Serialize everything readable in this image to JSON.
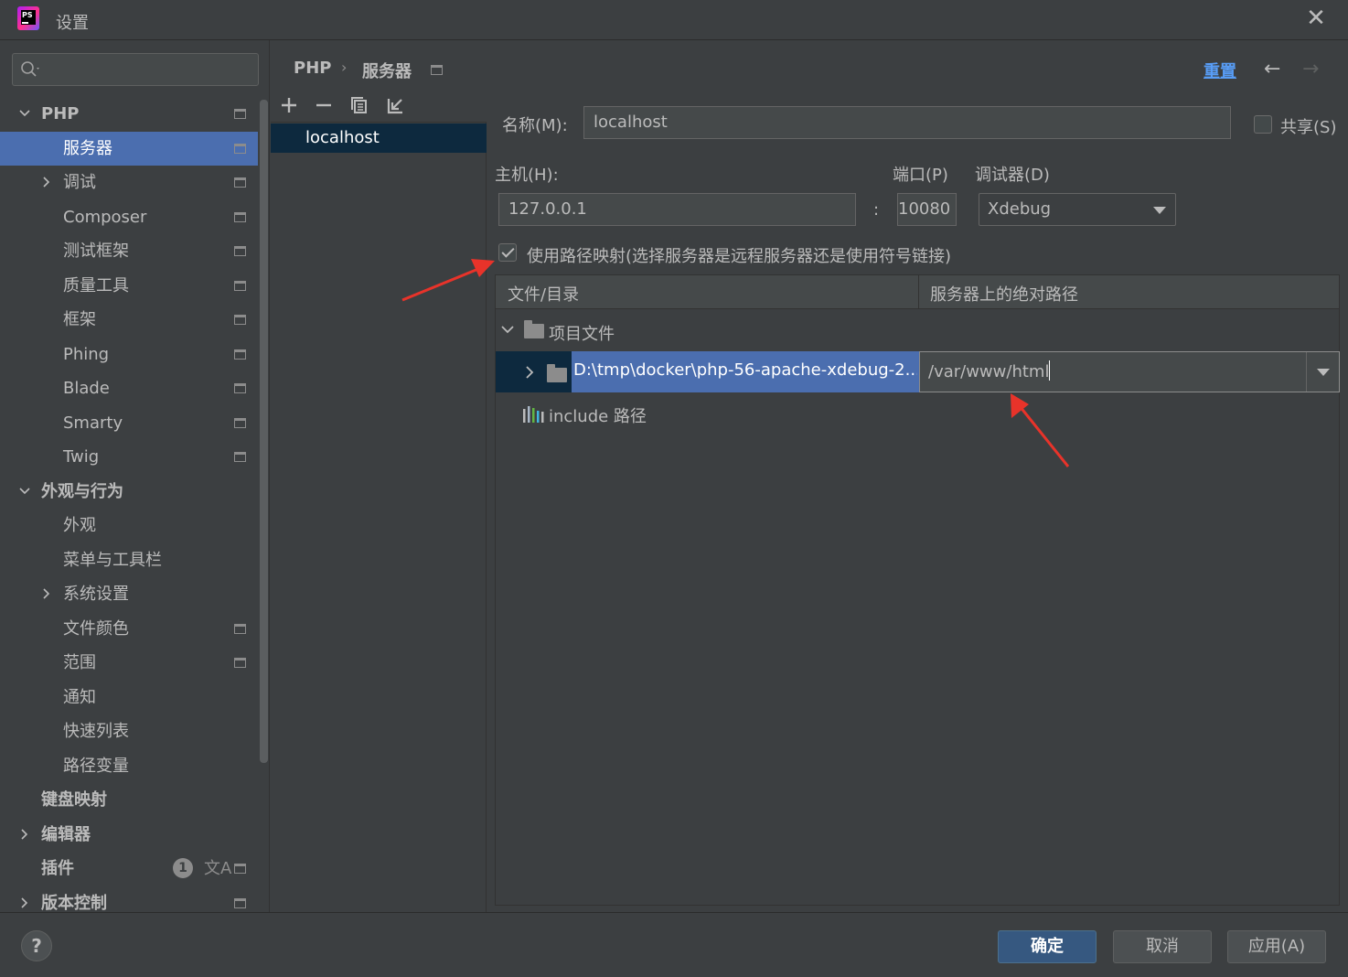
{
  "window": {
    "title": "设置",
    "app_icon_text": "PS"
  },
  "search": {
    "placeholder": ""
  },
  "sidebar": {
    "items": [
      {
        "label": "PHP",
        "level": 0,
        "expand": "expanded",
        "bold": true,
        "project_icon": true
      },
      {
        "label": "服务器",
        "level": 1,
        "expand": "none",
        "selected": true,
        "project_icon": true
      },
      {
        "label": "调试",
        "level": 1,
        "expand": "collapsed",
        "project_icon": true
      },
      {
        "label": "Composer",
        "level": 1,
        "expand": "none",
        "project_icon": true
      },
      {
        "label": "测试框架",
        "level": 1,
        "expand": "none",
        "project_icon": true
      },
      {
        "label": "质量工具",
        "level": 1,
        "expand": "none",
        "project_icon": true
      },
      {
        "label": "框架",
        "level": 1,
        "expand": "none",
        "project_icon": true
      },
      {
        "label": "Phing",
        "level": 1,
        "expand": "none",
        "project_icon": true
      },
      {
        "label": "Blade",
        "level": 1,
        "expand": "none",
        "project_icon": true
      },
      {
        "label": "Smarty",
        "level": 1,
        "expand": "none",
        "project_icon": true
      },
      {
        "label": "Twig",
        "level": 1,
        "expand": "none",
        "project_icon": true
      },
      {
        "label": "外观与行为",
        "level": 0,
        "expand": "expanded",
        "bold": true
      },
      {
        "label": "外观",
        "level": 1,
        "expand": "none"
      },
      {
        "label": "菜单与工具栏",
        "level": 1,
        "expand": "none"
      },
      {
        "label": "系统设置",
        "level": 1,
        "expand": "collapsed"
      },
      {
        "label": "文件颜色",
        "level": 1,
        "expand": "none",
        "project_icon": true
      },
      {
        "label": "范围",
        "level": 1,
        "expand": "none",
        "project_icon": true
      },
      {
        "label": "通知",
        "level": 1,
        "expand": "none"
      },
      {
        "label": "快速列表",
        "level": 1,
        "expand": "none"
      },
      {
        "label": "路径变量",
        "level": 1,
        "expand": "none"
      },
      {
        "label": "键盘映射",
        "level": 0,
        "expand": "none",
        "bold": true
      },
      {
        "label": "编辑器",
        "level": 0,
        "expand": "collapsed",
        "bold": true
      },
      {
        "label": "插件",
        "level": 0,
        "expand": "none",
        "bold": true,
        "badge": "1",
        "lang_icon": "文A",
        "project_icon": true
      },
      {
        "label": "版本控制",
        "level": 0,
        "expand": "collapsed",
        "bold": true,
        "project_icon": true
      }
    ]
  },
  "breadcrumb": {
    "parent": "PHP",
    "separator": "›",
    "current": "服务器"
  },
  "header": {
    "reset_label": "重置",
    "back_icon": "←",
    "forward_icon": "→"
  },
  "server_list": {
    "toolbar": [
      "add-icon",
      "remove-icon",
      "copy-icon",
      "import-icon"
    ],
    "items": [
      "localhost"
    ]
  },
  "form": {
    "name_label": "名称(M):",
    "name_value": "localhost",
    "share_label": "共享(S)",
    "share_checked": false,
    "host_label": "主机(H):",
    "host_value": "127.0.0.1",
    "port_sep": ":",
    "port_label": "端口(P)",
    "port_value": "10080",
    "debugger_label": "调试器(D)",
    "debugger_value": "Xdebug",
    "use_mapping_label": "使用路径映射(选择服务器是远程服务器还是使用符号链接)",
    "use_mapping_checked": true
  },
  "mapping_table": {
    "col_file": "文件/目录",
    "col_server": "服务器上的绝对路径",
    "group_label": "项目文件",
    "row_path": "D:\\tmp\\docker\\php-56-apache-xdebug-2...",
    "row_server_path": "/var/www/html",
    "include_label": "include 路径"
  },
  "buttons": {
    "help": "?",
    "ok": "确定",
    "cancel": "取消",
    "apply": "应用(A)"
  },
  "colors": {
    "accent": "#4b6eaf",
    "link": "#589df6",
    "annotation": "#e8332a"
  }
}
